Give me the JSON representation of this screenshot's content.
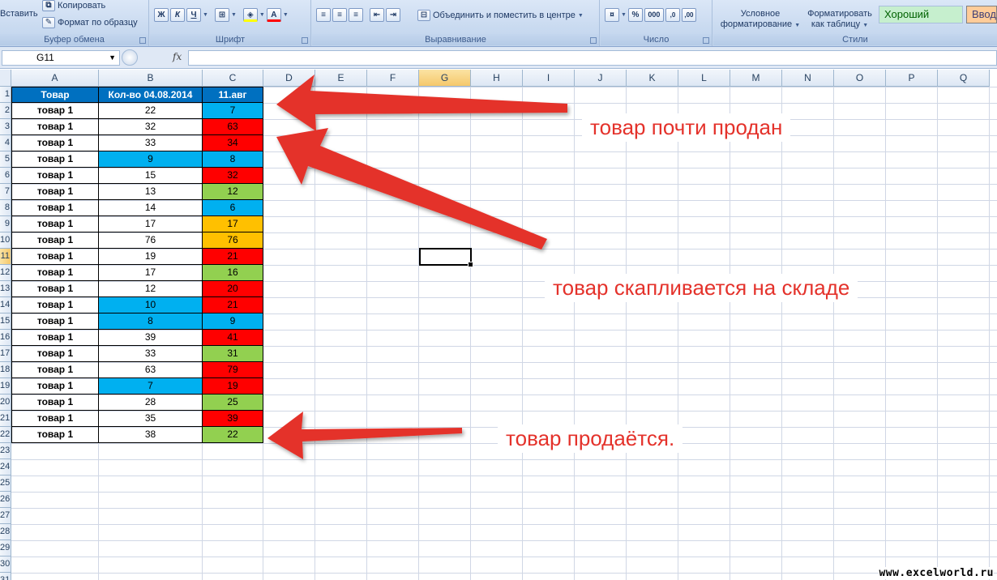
{
  "ribbon": {
    "paste": "Вставить",
    "copy": "Копировать",
    "format_painter": "Формат по образцу",
    "clipboard_group": "Буфер обмена",
    "bold": "Ж",
    "italic": "К",
    "underline": "Ч",
    "font_group": "Шрифт",
    "merge_center": "Объединить и поместить в центре",
    "alignment_group": "Выравнивание",
    "percent": "%",
    "thousands": "000",
    "number_group": "Число",
    "conditional_formatting": "Условное форматирование",
    "format_as_table": "Форматировать как таблицу",
    "style_good": "Хороший",
    "style_input": "Ввод",
    "styles_group": "Стили"
  },
  "formula_bar": {
    "name_box": "G11",
    "fx_label": "fx",
    "value": ""
  },
  "columns": [
    "A",
    "B",
    "C",
    "D",
    "E",
    "F",
    "G",
    "H",
    "I",
    "J",
    "K",
    "L",
    "M",
    "N",
    "O",
    "P",
    "Q"
  ],
  "selected_column": "G",
  "selected_row": 11,
  "row_numbers": [
    "1",
    "2",
    "3",
    "4",
    "5",
    "6",
    "7",
    "8",
    "9",
    "10",
    "11",
    "12",
    "13",
    "14",
    "15",
    "16",
    "17",
    "18",
    "19",
    "20",
    "21",
    "22",
    "23",
    "24",
    "25",
    "26",
    "27",
    "28",
    "29",
    "30",
    "31"
  ],
  "table": {
    "headers": [
      "Товар",
      "Кол-во 04.08.2014",
      "11.авг"
    ],
    "rows": [
      {
        "product": "товар 1",
        "qty": "22",
        "aug11": "7"
      },
      {
        "product": "товар 1",
        "qty": "32",
        "aug11": "63"
      },
      {
        "product": "товар 1",
        "qty": "33",
        "aug11": "34"
      },
      {
        "product": "товар 1",
        "qty": "9",
        "aug11": "8"
      },
      {
        "product": "товар 1",
        "qty": "15",
        "aug11": "32"
      },
      {
        "product": "товар 1",
        "qty": "13",
        "aug11": "12"
      },
      {
        "product": "товар 1",
        "qty": "14",
        "aug11": "6"
      },
      {
        "product": "товар 1",
        "qty": "17",
        "aug11": "17"
      },
      {
        "product": "товар 1",
        "qty": "76",
        "aug11": "76"
      },
      {
        "product": "товар 1",
        "qty": "19",
        "aug11": "21"
      },
      {
        "product": "товар 1",
        "qty": "17",
        "aug11": "16"
      },
      {
        "product": "товар 1",
        "qty": "12",
        "aug11": "20"
      },
      {
        "product": "товар 1",
        "qty": "10",
        "aug11": "21"
      },
      {
        "product": "товар 1",
        "qty": "8",
        "aug11": "9"
      },
      {
        "product": "товар 1",
        "qty": "39",
        "aug11": "41"
      },
      {
        "product": "товар 1",
        "qty": "33",
        "aug11": "31"
      },
      {
        "product": "товар 1",
        "qty": "63",
        "aug11": "79"
      },
      {
        "product": "товар 1",
        "qty": "7",
        "aug11": "19"
      },
      {
        "product": "товар 1",
        "qty": "28",
        "aug11": "25"
      },
      {
        "product": "товар 1",
        "qty": "35",
        "aug11": "39"
      },
      {
        "product": "товар 1",
        "qty": "38",
        "aug11": "22"
      }
    ],
    "b_fill": [
      "",
      "",
      "",
      "#00b0f0",
      "",
      "",
      "",
      "",
      "",
      "",
      "",
      "",
      "#00b0f0",
      "#00b0f0",
      "",
      "",
      "",
      "#00b0f0",
      "",
      "",
      ""
    ],
    "c_fill": [
      "#00b0f0",
      "#ff0000",
      "#ff0000",
      "#00b0f0",
      "#ff0000",
      "#92d050",
      "#00b0f0",
      "#ffc000",
      "#ffc000",
      "#ff0000",
      "#92d050",
      "#ff0000",
      "#ff0000",
      "#00b0f0",
      "#ff0000",
      "#92d050",
      "#ff0000",
      "#ff0000",
      "#92d050",
      "#ff0000",
      "#92d050"
    ]
  },
  "annotations": {
    "almost_sold": "товар почти продан",
    "accumulating": "товар скапливается на складе",
    "selling": "товар продаётся."
  },
  "colors": {
    "header_blue": "#0070c0",
    "arrow_red": "#e4322b"
  },
  "watermark": "www.excelworld.ru"
}
